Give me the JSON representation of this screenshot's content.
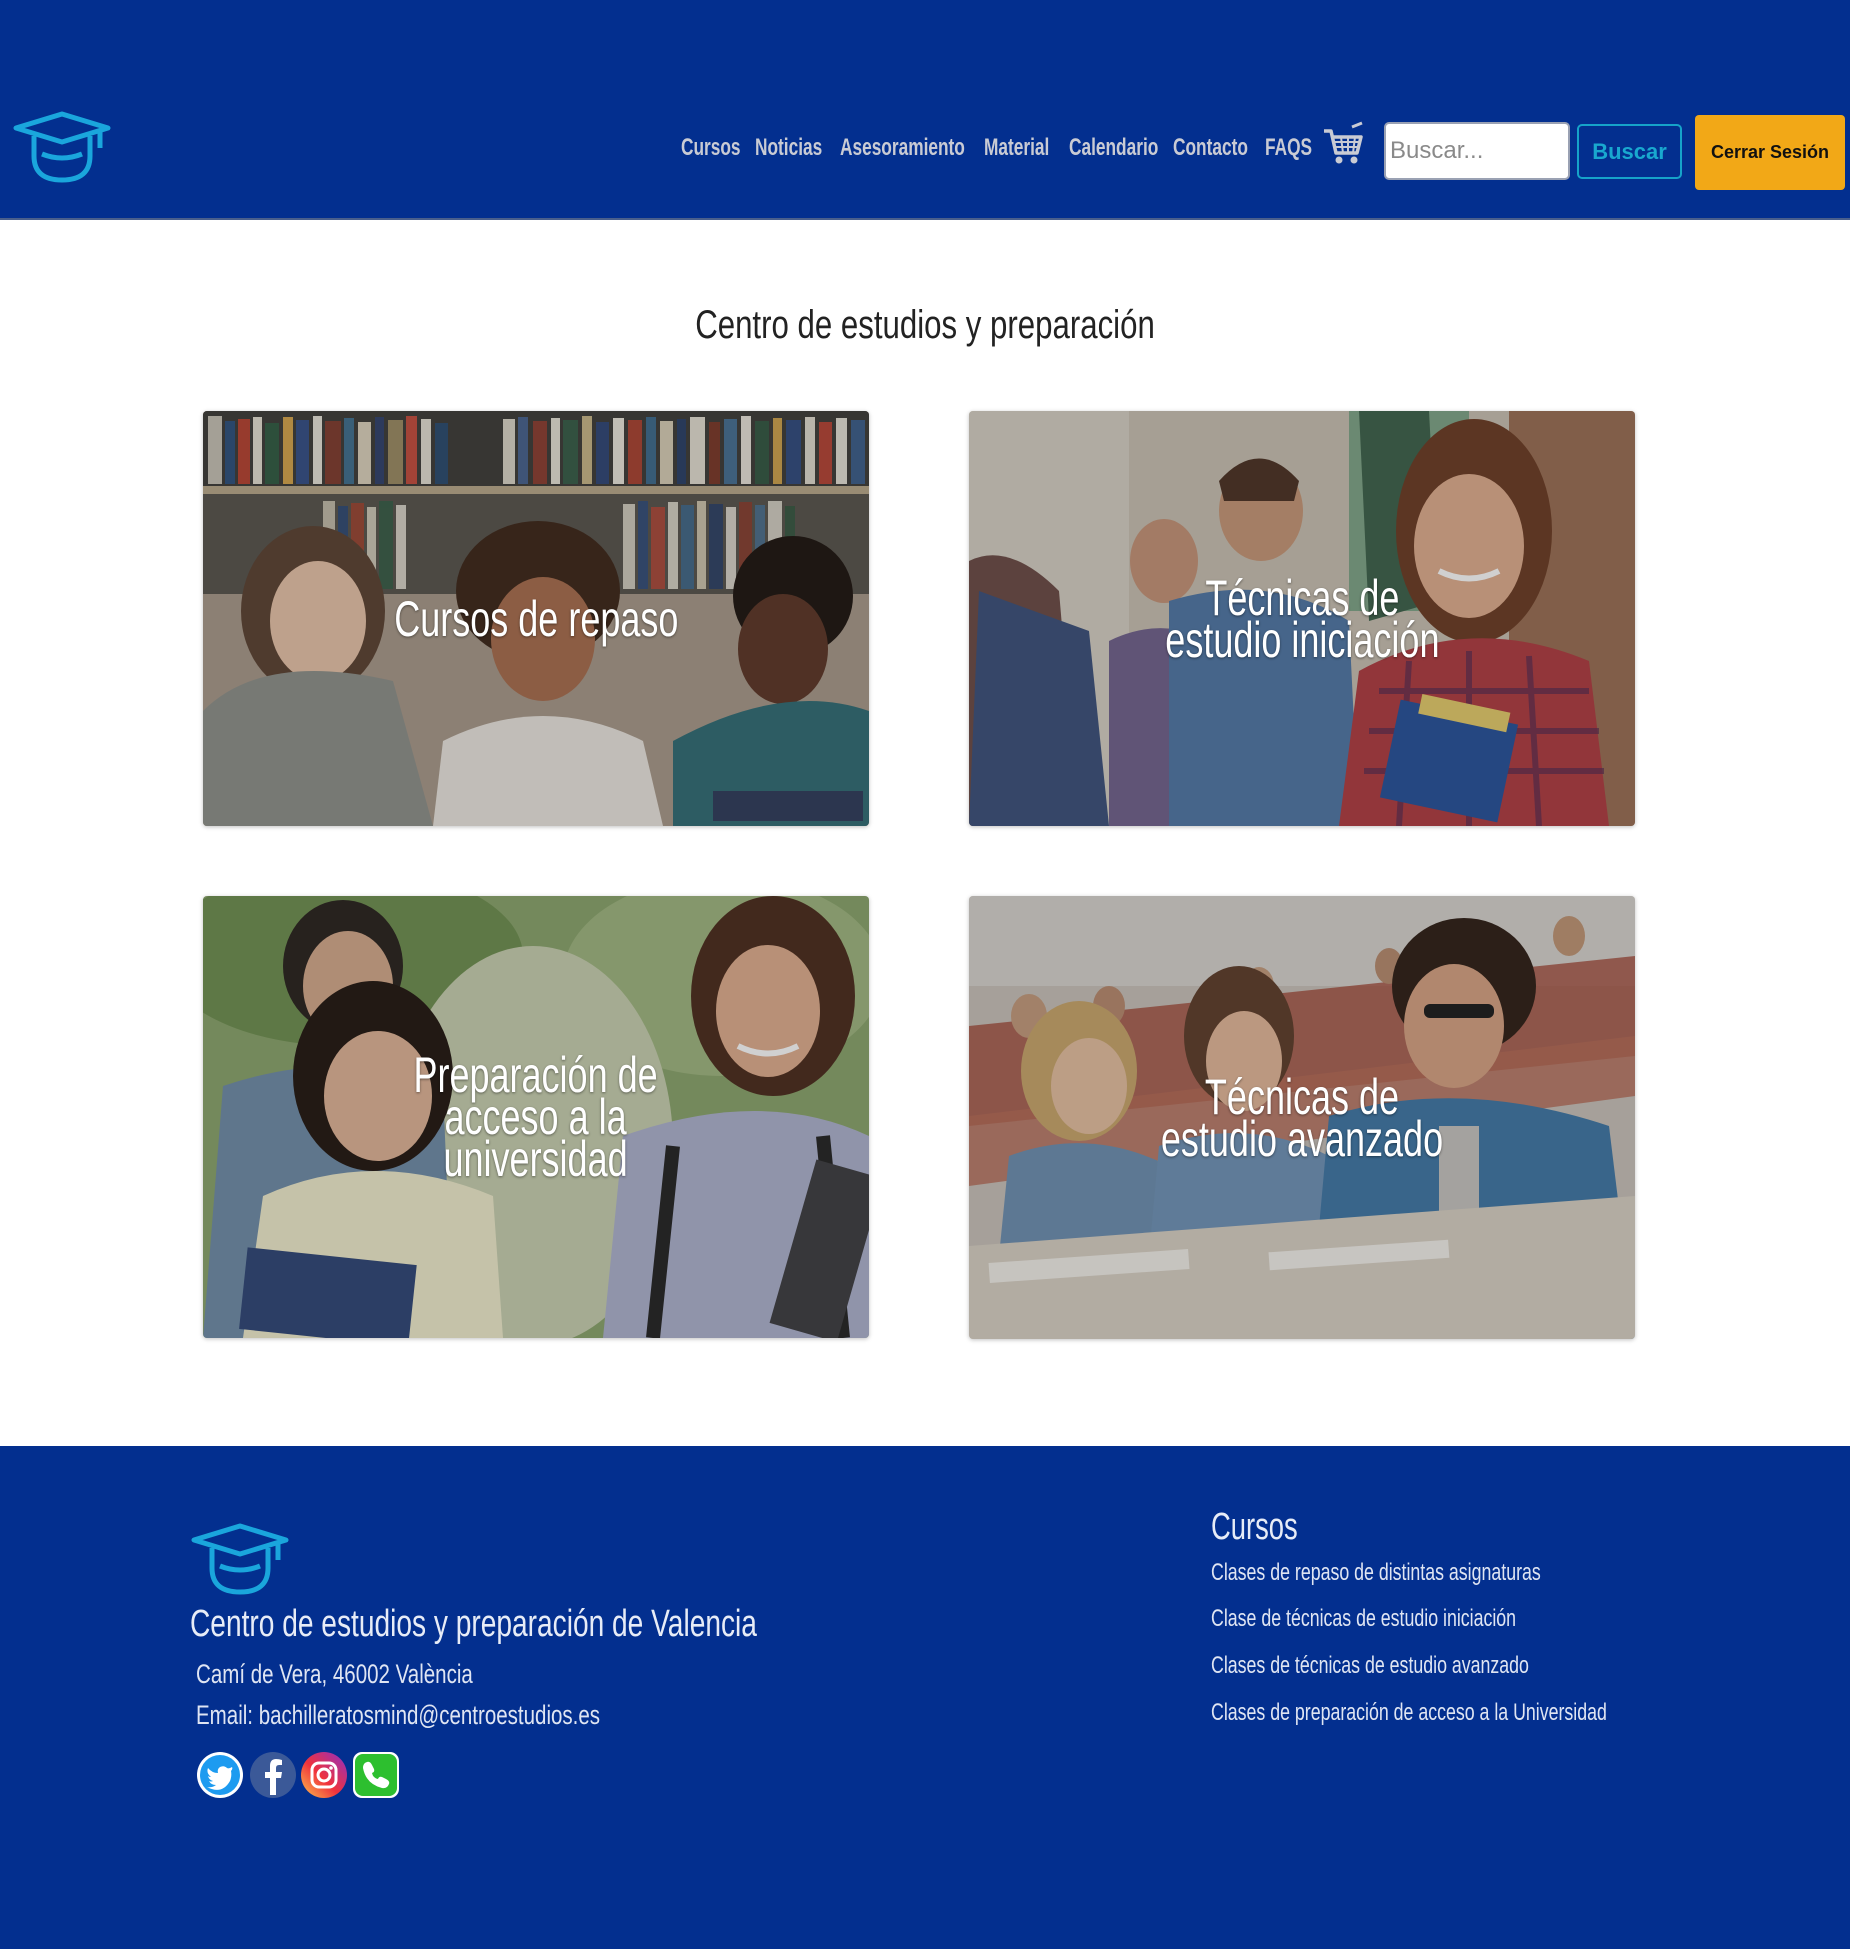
{
  "header": {
    "nav": [
      "Cursos",
      "Noticias",
      "Asesoramiento",
      "Material",
      "Calendario",
      "Contacto",
      "FAQS"
    ],
    "search_placeholder": "Buscar...",
    "search_button": "Buscar",
    "logout_button": "Cerrar Sesión"
  },
  "main": {
    "title": "Centro de estudios y preparación",
    "cards": [
      {
        "title": "Cursos de repaso"
      },
      {
        "title": "Técnicas de\nestudio iniciación"
      },
      {
        "title": "Preparación de\nacceso a la\nuniversidad"
      },
      {
        "title": "Técnicas de\nestudio avanzado"
      }
    ]
  },
  "footer": {
    "org_name": "Centro de estudios y preparación de Valencia",
    "address": "Camí de Vera, 46002 València",
    "email": "Email: bachilleratosmind@centroestudios.es",
    "courses_title": "Cursos",
    "courses": [
      "Clases de repaso de distintas asignaturas",
      "Clase de técnicas de estudio iniciación",
      "Clases de técnicas de estudio avanzado",
      "Clases de preparación de acceso a la Universidad"
    ],
    "social": [
      "twitter-icon",
      "facebook-icon",
      "instagram-icon",
      "phone-icon"
    ]
  },
  "colors": {
    "brand_blue": "#032f8f",
    "accent_cyan": "#19a8cf",
    "logout_orange": "#f2a817"
  }
}
